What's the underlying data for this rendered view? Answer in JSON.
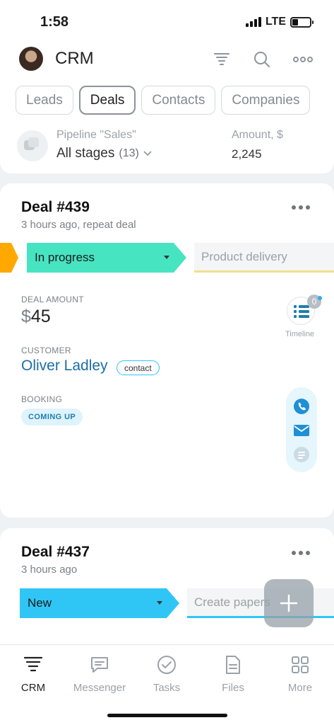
{
  "status_bar": {
    "time": "1:58",
    "network": "LTE"
  },
  "header": {
    "title": "CRM",
    "icons": [
      "funnel-icon",
      "search-icon",
      "more-icon"
    ]
  },
  "tabs": [
    {
      "label": "Leads"
    },
    {
      "label": "Deals",
      "active": true
    },
    {
      "label": "Contacts"
    },
    {
      "label": "Companies"
    }
  ],
  "filter": {
    "pipeline_label": "Pipeline \"Sales\"",
    "stage_value": "All stages",
    "stage_count": "(13)",
    "amount_label": "Amount, $",
    "amount_value": "2,245"
  },
  "deals": [
    {
      "title": "Deal #439",
      "subtitle": "3 hours ago, repeat deal",
      "stage": "In progress",
      "stage_color": "#47e4c2",
      "next_stage": "Product delivery",
      "next_stage_color": "#f0e08a",
      "amount_label": "DEAL AMOUNT",
      "amount_currency": "$",
      "amount_value": "45",
      "customer_label": "CUSTOMER",
      "customer_name": "Oliver Ladley",
      "customer_type": "contact",
      "booking_label": "BOOKING",
      "booking_status": "COMING UP",
      "timeline_count": "0",
      "timeline_label": "Timeline"
    },
    {
      "title": "Deal #437",
      "subtitle": "3 hours ago",
      "stage": "New",
      "stage_color": "#2fc6f6",
      "next_stage": "Create papers",
      "next_stage_color": "#2fc6f6"
    }
  ],
  "bottom_nav": [
    {
      "label": "CRM",
      "icon": "crm-icon",
      "active": true
    },
    {
      "label": "Messenger",
      "icon": "chat-icon"
    },
    {
      "label": "Tasks",
      "icon": "check-circle-icon"
    },
    {
      "label": "Files",
      "icon": "file-icon"
    },
    {
      "label": "More",
      "icon": "grid-icon"
    }
  ],
  "colors": {
    "accent": "#2fc6f6",
    "link": "#1a6ea8",
    "in_progress": "#47e4c2",
    "orange": "#ffa900"
  }
}
